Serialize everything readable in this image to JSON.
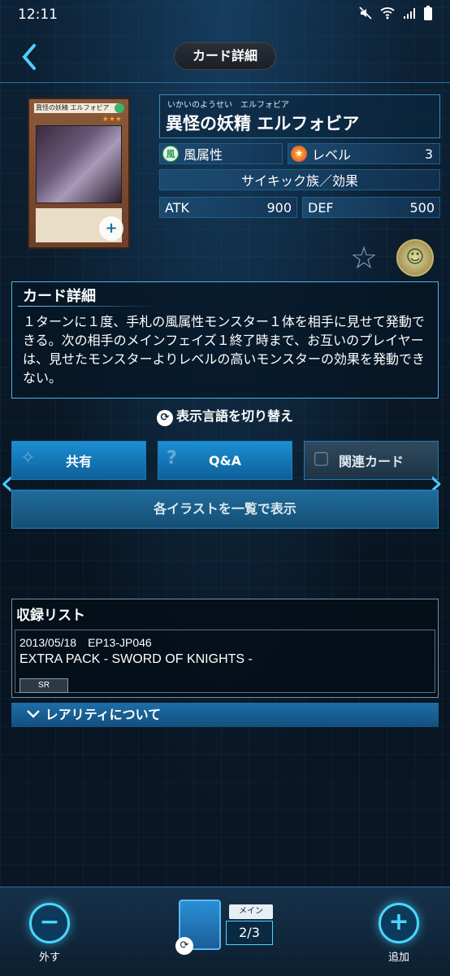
{
  "status": {
    "time": "12:11",
    "battery": "▮"
  },
  "header": {
    "back_icon": "back-chevron-icon",
    "title": "カード詳細"
  },
  "card": {
    "ruby": "いかいのようせい　エルフォビア",
    "name": "異怪の妖精 エルフォビア",
    "image_name": "異怪の妖精 エルフォビア",
    "attribute_icon_text": "風",
    "attribute": "風属性",
    "level_label": "レベル",
    "level": "3",
    "type": "サイキック族／効果",
    "atk_label": "ATK",
    "atk": "900",
    "def_label": "DEF",
    "def": "500"
  },
  "description": {
    "title": "カード詳細",
    "text": "１ターンに１度、手札の風属性モンスター１体を相手に見せて発動できる。次の相手のメインフェイズ１終了時まで、お互いのプレイヤーは、見せたモンスターよりレベルの高いモンスターの効果を発動できない。"
  },
  "language_toggle": "表示言語を切り替え",
  "tabs": {
    "share": "共有",
    "qa": "Q&A",
    "related": "関連カード"
  },
  "illust_button": "各イラストを一覧で表示",
  "records": {
    "title": "収録リスト",
    "date_code": "2013/05/18　EP13-JP046",
    "pack": "EXTRA PACK - SWORD OF KNIGHTS -",
    "rarity": "SR",
    "rarity_about": "レアリティについて"
  },
  "bottom": {
    "remove_label": "外す",
    "add_label": "追加",
    "deck_label": "メイン",
    "deck_count": "2/3"
  },
  "colors": {
    "accent": "#4ad6ff",
    "tab_active": "#1b8fd4",
    "background": "#0a1522"
  }
}
